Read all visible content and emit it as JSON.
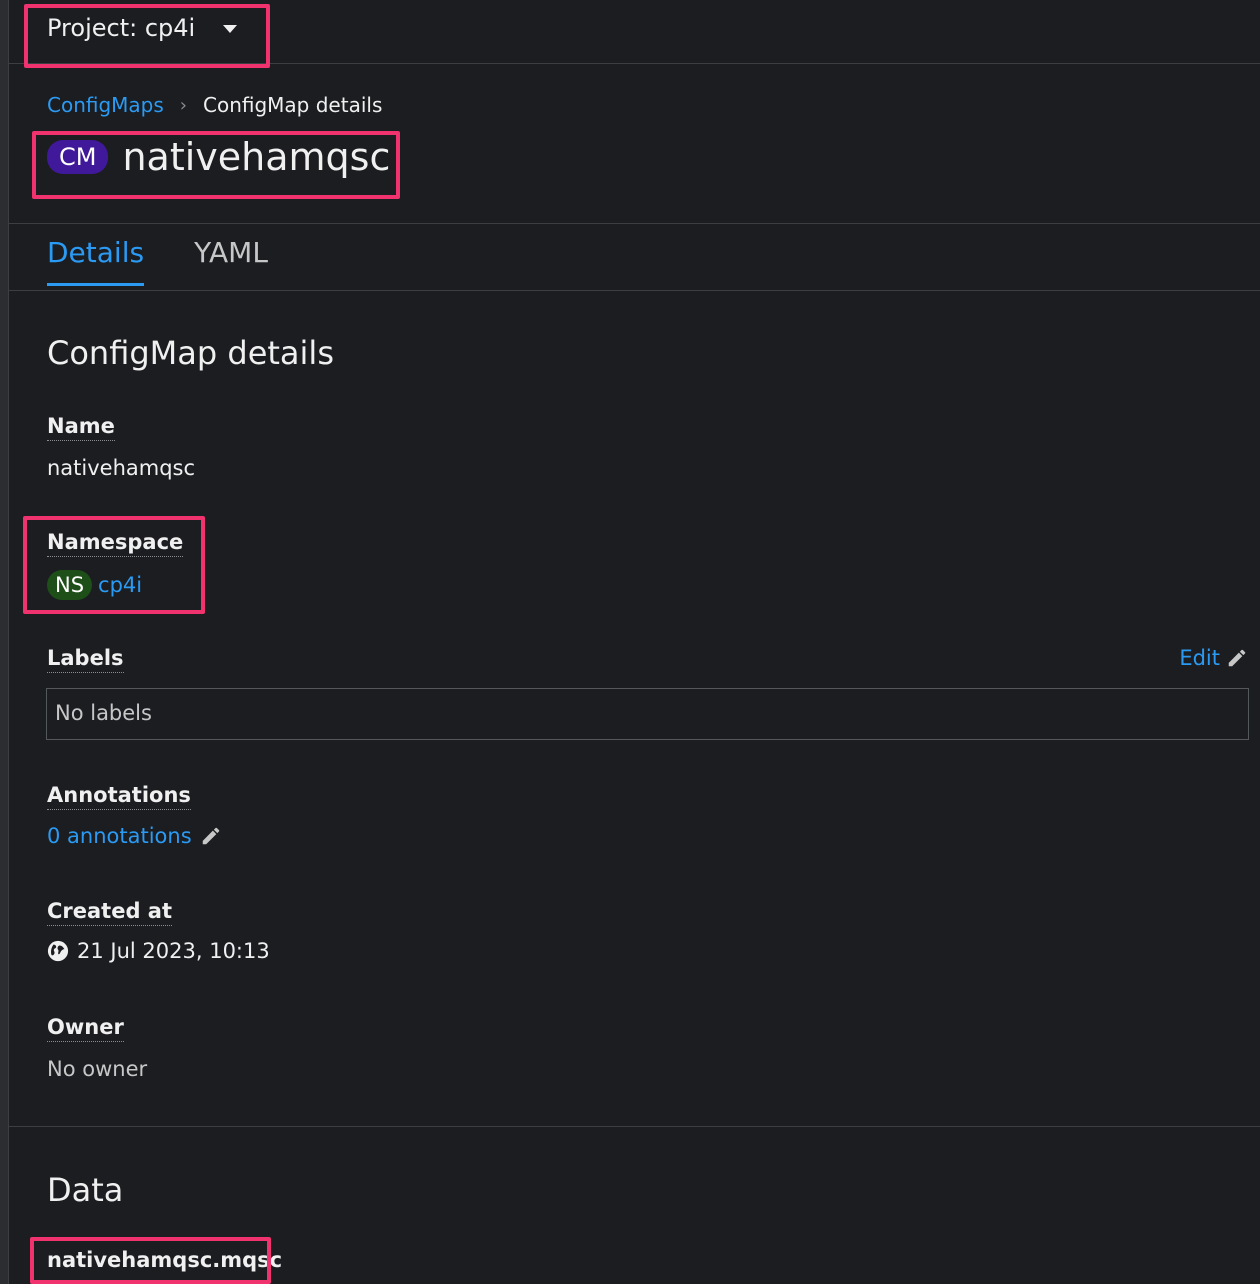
{
  "project": {
    "label": "Project: cp4i"
  },
  "breadcrumb": {
    "parent": "ConfigMaps",
    "separator": "›",
    "current": "ConfigMap details"
  },
  "resource": {
    "kind_badge": "CM",
    "name": "nativehamqsc"
  },
  "tabs": [
    {
      "label": "Details",
      "active": true
    },
    {
      "label": "YAML",
      "active": false
    }
  ],
  "details": {
    "section_title": "ConfigMap details",
    "name_label": "Name",
    "name_value": "nativehamqsc",
    "namespace_label": "Namespace",
    "namespace_badge": "NS",
    "namespace_value": "cp4i",
    "labels_label": "Labels",
    "labels_edit": "Edit",
    "labels_empty": "No labels",
    "annotations_label": "Annotations",
    "annotations_value": "0 annotations",
    "created_label": "Created at",
    "created_value": "21 Jul 2023, 10:13",
    "owner_label": "Owner",
    "owner_value": "No owner"
  },
  "data_section": {
    "title": "Data",
    "key": "nativehamqsc.mqsc"
  },
  "colors": {
    "accent": "#2b9af3",
    "highlight": "#f0326e",
    "cm_badge": "#40199a",
    "ns_badge": "#1e4f18",
    "background": "#1b1d21"
  },
  "icons": [
    "caret-down-icon",
    "chevron-right-icon",
    "pencil-icon",
    "globe-icon"
  ]
}
